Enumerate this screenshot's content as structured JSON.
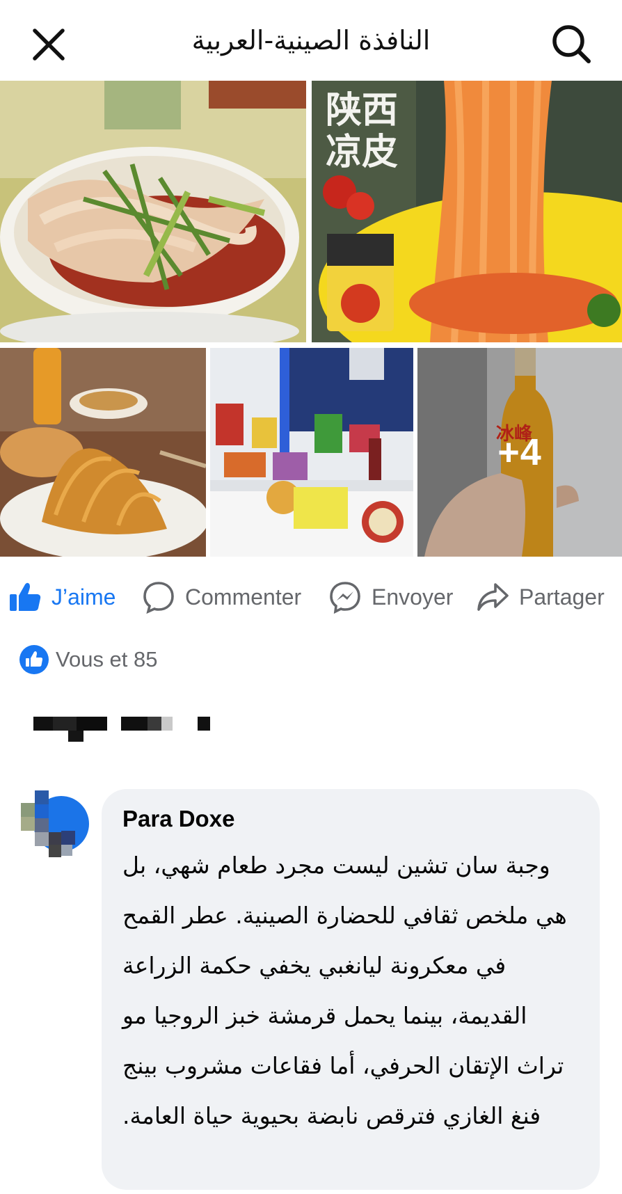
{
  "header": {
    "title": "النافذة الصينية-العربية",
    "close_icon": "close-icon",
    "search_icon": "search-icon"
  },
  "photos": {
    "more_count": "+4",
    "items": [
      {
        "name": "photo-liangpi-bowl"
      },
      {
        "name": "photo-liangpi-package"
      },
      {
        "name": "photo-noodle-plate"
      },
      {
        "name": "photo-products-table"
      },
      {
        "name": "photo-soda-bottle"
      }
    ],
    "package_text": "陕西凉皮",
    "bottle_text": "冰峰"
  },
  "actions": {
    "like_label": "J’aime",
    "comment_label": "Commenter",
    "send_label": "Envoyer",
    "share_label": "Partager"
  },
  "reactions": {
    "text": "Vous et 85"
  },
  "comment": {
    "author": "Para Doxe",
    "text": "وجبة سان تشين ليست مجرد طعام شهي، بل هي ملخص ثقافي للحضارة الصينية. عطر القمح في معكرونة ليانغبي يخفي حكمة الزراعة القديمة، بينما يحمل قرمشة خبز الروجيا مو تراث الإتقان الحرفي، أما فقاعات مشروب بينج فنغ الغازي فترقص نابضة بحيوية حياة العامة."
  },
  "colors": {
    "accent": "#1877f2",
    "muted": "#65676b",
    "bubble": "#f0f2f5"
  }
}
